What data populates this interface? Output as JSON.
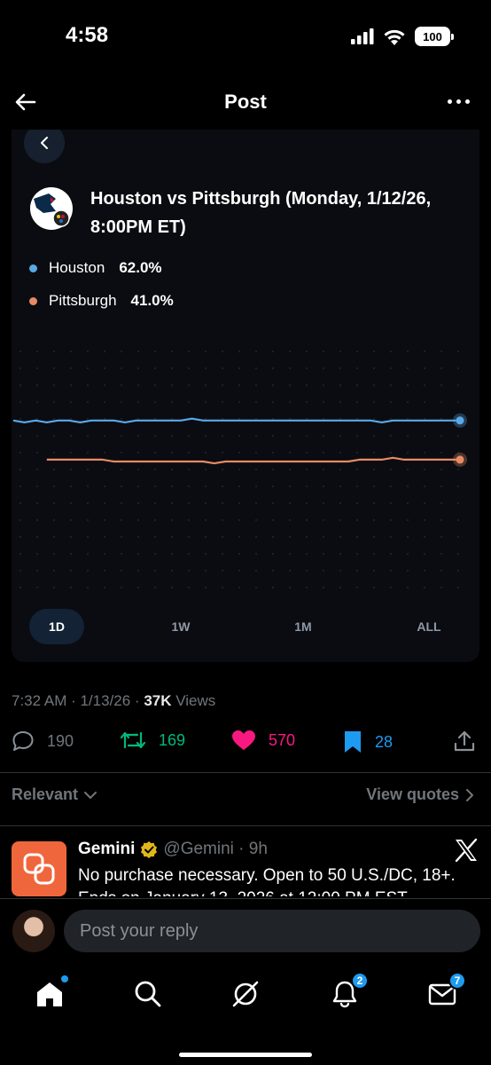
{
  "status_bar": {
    "time": "4:58",
    "battery": "100"
  },
  "nav": {
    "title": "Post"
  },
  "card": {
    "title": "Houston vs Pittsburgh (Monday, 1/12/26, 8:00PM ET)",
    "legend": [
      {
        "team": "Houston",
        "pct": "62.0%",
        "color": "#5aa9e6"
      },
      {
        "team": "Pittsburgh",
        "pct": "41.0%",
        "color": "#e88a66"
      }
    ],
    "ranges": [
      "1D",
      "1W",
      "1M",
      "ALL"
    ],
    "active_range": "1D"
  },
  "chart_data": {
    "type": "line",
    "series": [
      {
        "name": "Houston",
        "color": "#5aa9e6",
        "values": [
          62,
          61,
          62,
          61,
          62,
          62,
          61,
          62,
          62,
          62,
          61,
          62,
          62,
          62,
          62,
          62,
          63,
          62,
          62,
          62,
          62,
          62,
          62,
          62,
          62,
          62,
          62,
          62,
          62,
          62,
          62,
          62,
          62,
          61,
          62,
          62,
          62,
          62,
          62,
          62,
          62
        ]
      },
      {
        "name": "Pittsburgh",
        "color": "#e88a66",
        "values": [
          null,
          null,
          null,
          41,
          41,
          41,
          41,
          41,
          41,
          40,
          40,
          40,
          40,
          40,
          40,
          40,
          40,
          40,
          39,
          40,
          40,
          40,
          40,
          40,
          40,
          40,
          40,
          40,
          40,
          40,
          40,
          41,
          41,
          41,
          42,
          41,
          41,
          41,
          41,
          41,
          41
        ]
      }
    ],
    "ylim": [
      0,
      100
    ]
  },
  "meta": {
    "time": "7:32 AM · 1/13/26 · ",
    "views_count": "37K",
    "views_label": " Views"
  },
  "actions": {
    "replies": "190",
    "reposts": "169",
    "likes": "570",
    "bookmarks": "28"
  },
  "filters": {
    "sort": "Relevant",
    "quotes": "View quotes"
  },
  "ad": {
    "name": "Gemini",
    "handle": "@Gemini · 9h",
    "text": "No purchase necessary. Open to 50 U.S./DC, 18+. Ends on January 13, 2026 at 12:00 PM EST"
  },
  "reply": {
    "placeholder": "Post your reply"
  },
  "tabs": {
    "notifications_badge": "2",
    "messages_badge": "7"
  }
}
